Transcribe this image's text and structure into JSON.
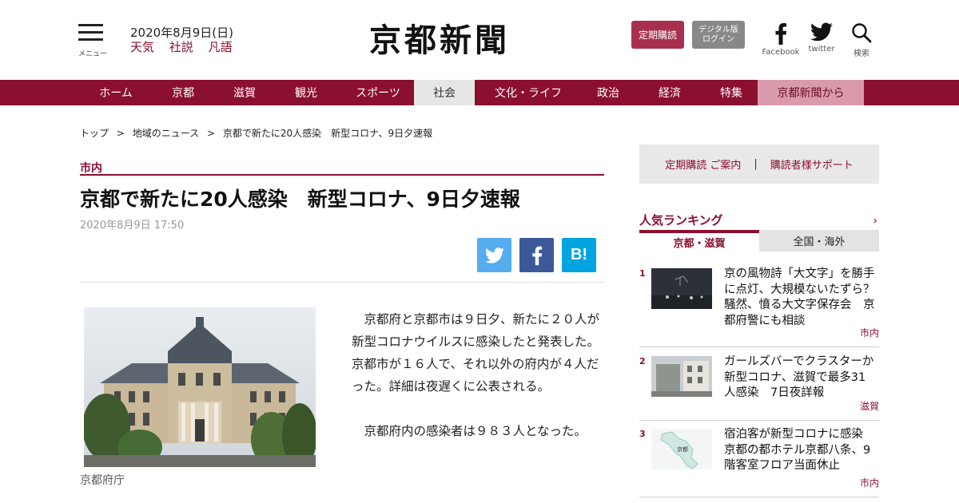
{
  "header": {
    "menu_label": "メニュー",
    "date": "2020年8月9日(日)",
    "links": [
      "天気",
      "社説",
      "凡語"
    ],
    "logo": "京都新聞",
    "subscribe_label": "定期購読",
    "login_line1": "デジタル版",
    "login_line2": "ログイン",
    "social": {
      "facebook": "Facebook",
      "twitter": "twitter",
      "search": "検索"
    }
  },
  "nav": {
    "items": [
      "ホーム",
      "京都",
      "滋賀",
      "観光",
      "スポーツ",
      "社会",
      "文化・ライフ",
      "政治",
      "経済",
      "特集",
      "京都新聞から"
    ],
    "active": "社会"
  },
  "breadcrumb": [
    "トップ",
    "地域のニュース",
    "京都で新たに20人感染　新型コロナ、9日夕速報"
  ],
  "article": {
    "category": "市内",
    "title": "京都で新たに20人感染　新型コロナ、9日夕速報",
    "published": "2020年8月9日 17:50",
    "share_hatena": "B!",
    "photo_caption": "京都府庁",
    "paragraphs": [
      "京都府と京都市は９日夕、新たに２０人が新型コロナウイルスに感染したと発表した。京都市が１６人で、それ以外の府内が４人だった。詳細は夜遅くに公表される。",
      "京都府内の感染者は９８３人となった。"
    ]
  },
  "sidebar": {
    "support_left": "定期購読 ご案内",
    "support_sep": "|",
    "support_right": "購読者様サポート",
    "ranking_title": "人気ランキング",
    "tabs": [
      "京都・滋賀",
      "全国・海外"
    ],
    "active_tab": "京都・滋賀",
    "ranking": [
      {
        "rank": "1",
        "text": "京の風物詩「大文字」を勝手に点灯、大規模ないたずら？　騒然、憤る大文字保存会　京都府警にも相談",
        "tag": "市内"
      },
      {
        "rank": "2",
        "text": "ガールズバーでクラスターか　新型コロナ、滋賀で最多31人感染　7日夜詳報",
        "tag": "滋賀"
      },
      {
        "rank": "3",
        "text": "宿泊客が新型コロナに感染　京都の都ホテル京都八条、9階客室フロア当面休止",
        "tag": "市内",
        "thumb_label": "京都"
      }
    ]
  },
  "colors": {
    "brand": "#8b0f2e",
    "active_nav_bg": "#e6e6e6",
    "extra_nav_bg": "#d99bab",
    "twitter": "#55acee",
    "facebook": "#3b5998",
    "hatena": "#00a4de"
  }
}
